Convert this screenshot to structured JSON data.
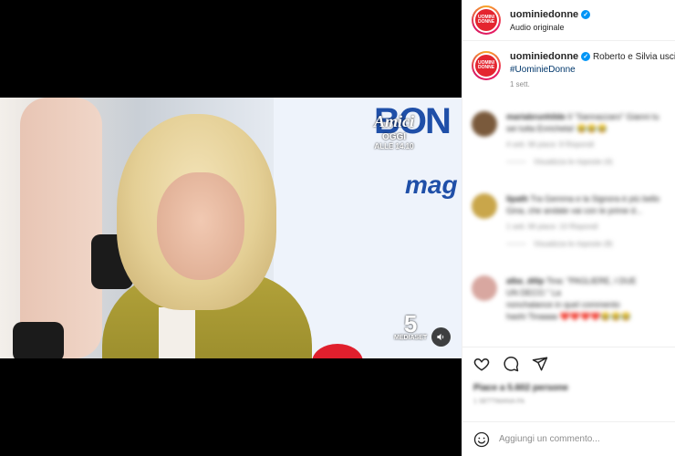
{
  "post": {
    "username": "uominiedonne",
    "audio": "Audio originale",
    "avatar_text": "UOMINI DONNE",
    "caption_prefix": "Roberto e Silvia uscir",
    "hashtag": "#UominieDonne",
    "age": "1 sett."
  },
  "video": {
    "overlay_logo": "Amici",
    "overlay_line1": "OGGI",
    "overlay_line2": "ALLE 14.10",
    "channel_number": "5",
    "channel_name": "MEDIASET",
    "wall_text_top": "BON",
    "wall_text_bottom": "mag"
  },
  "comments": [
    {
      "user": "mariabrunhilde",
      "text": "Il \"Sannazzaro\" Gianni tu",
      "text2": "sei tutta Enricheta!",
      "emoji": "😂😂😂",
      "meta": "4 sett.   Mi piace: 8   Rispondi",
      "replies": "Visualizza le risposte (4)",
      "avatar_color": "#7a5a3c"
    },
    {
      "user": "lipath",
      "text": "Tra Gemma e la Signora è più bello",
      "text2": "Gina, che andate vai con le prime d...",
      "emoji": "",
      "meta": "1 sett.   Mi piace: 10   Rispondi",
      "replies": "Visualizza le risposte (8)",
      "avatar_color": "#c9a64a"
    },
    {
      "user": "alba_dilip",
      "text": "Tina: \"PAGLIERE, I DUE",
      "text2": "UN DECO.\" La",
      "text3": "nonchalance in quel commento",
      "text4": "hashi Tinaaaa",
      "emoji": "❤️❤️❤️❤️😂😂😂",
      "meta": "",
      "replies": "",
      "avatar_color": "#d8a7a0"
    }
  ],
  "likes_label": "Piace a 5.602 persone",
  "date_label": "1 SETTIMANA FA",
  "comment_placeholder": "Aggiungi un commento...",
  "icons": {
    "like": "heart-icon",
    "comment": "comment-icon",
    "share": "paper-plane-icon",
    "emoji": "smiley-icon",
    "sound": "speaker-icon",
    "verified": "verified-badge-icon"
  },
  "colors": {
    "brand_red": "#e4252f",
    "verified_blue": "#0095f6",
    "hashtag": "#00376b"
  }
}
